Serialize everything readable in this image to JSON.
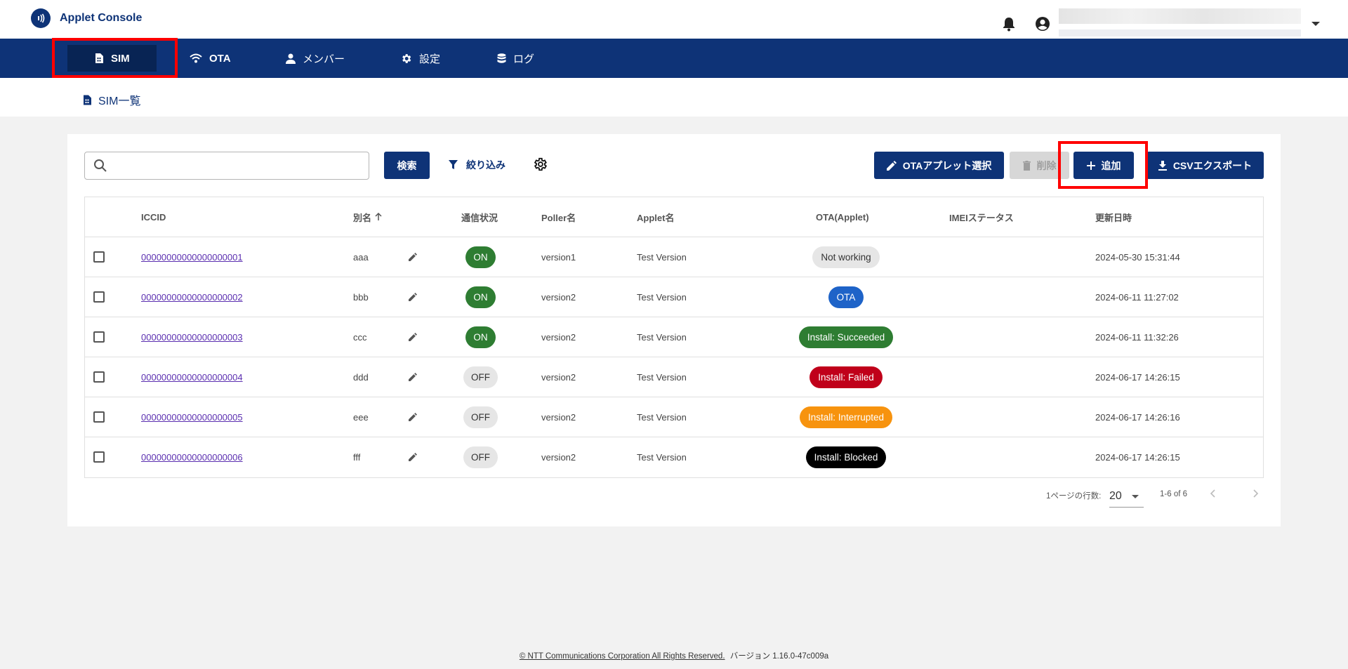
{
  "app": {
    "title": "Applet Console"
  },
  "nav": {
    "items": [
      {
        "label": "SIM",
        "icon": "sim-card-icon"
      },
      {
        "label": "OTA",
        "icon": "wifi-icon"
      },
      {
        "label": "メンバー",
        "icon": "person-icon"
      },
      {
        "label": "設定",
        "icon": "gear-icon"
      },
      {
        "label": "ログ",
        "icon": "database-icon"
      }
    ],
    "active": "SIM"
  },
  "breadcrumb": {
    "label": "SIM一覧"
  },
  "toolbar": {
    "search_placeholder": "",
    "search_label": "検索",
    "filter_label": "絞り込み",
    "ota_label": "OTAアプレット選択",
    "delete_label": "削除",
    "add_label": "追加",
    "csv_label": "CSVエクスポート"
  },
  "table": {
    "headers": [
      "ICCID",
      "別名",
      "通信状況",
      "Poller名",
      "Applet名",
      "OTA(Applet)",
      "IMEIステータス",
      "更新日時"
    ],
    "rows": [
      {
        "iccid": "00000000000000000001",
        "alias": "aaa",
        "status": "ON",
        "poller": "version1",
        "applet": "Test Version",
        "ota": "Not working",
        "imei": "",
        "updated": "2024-05-30 15:31:44"
      },
      {
        "iccid": "00000000000000000002",
        "alias": "bbb",
        "status": "ON",
        "poller": "version2",
        "applet": "Test Version",
        "ota": "OTA",
        "imei": "",
        "updated": "2024-06-11 11:27:02"
      },
      {
        "iccid": "00000000000000000003",
        "alias": "ccc",
        "status": "ON",
        "poller": "version2",
        "applet": "Test Version",
        "ota": "Install: Succeeded",
        "imei": "",
        "updated": "2024-06-11 11:32:26"
      },
      {
        "iccid": "00000000000000000004",
        "alias": "ddd",
        "status": "OFF",
        "poller": "version2",
        "applet": "Test Version",
        "ota": "Install: Failed",
        "imei": "",
        "updated": "2024-06-17 14:26:15"
      },
      {
        "iccid": "00000000000000000005",
        "alias": "eee",
        "status": "OFF",
        "poller": "version2",
        "applet": "Test Version",
        "ota": "Install: Interrupted",
        "imei": "",
        "updated": "2024-06-17 14:26:16"
      },
      {
        "iccid": "00000000000000000006",
        "alias": "fff",
        "status": "OFF",
        "poller": "version2",
        "applet": "Test Version",
        "ota": "Install: Blocked",
        "imei": "",
        "updated": "2024-06-17 14:26:15"
      }
    ]
  },
  "ota_colors": {
    "Not working": {
      "bg": "#e6e6e6",
      "fg": "#333333"
    },
    "OTA": {
      "bg": "#1e63c8",
      "fg": "#ffffff"
    },
    "Install: Succeeded": {
      "bg": "#2e7d32",
      "fg": "#ffffff"
    },
    "Install: Failed": {
      "bg": "#c0001a",
      "fg": "#ffffff"
    },
    "Install: Interrupted": {
      "bg": "#f7930e",
      "fg": "#ffffff"
    },
    "Install: Blocked": {
      "bg": "#000000",
      "fg": "#ffffff"
    }
  },
  "pagination": {
    "rows_per_page_label": "1ページの行数:",
    "rows_per_page": "20",
    "range": "1-6 of 6"
  },
  "footer": {
    "copyright": "© NTT Communications Corporation All Rights Reserved.",
    "version": "バージョン 1.16.0-47c009a"
  },
  "colors": {
    "brand": "#0e3377",
    "highlight": "#ff0000"
  }
}
